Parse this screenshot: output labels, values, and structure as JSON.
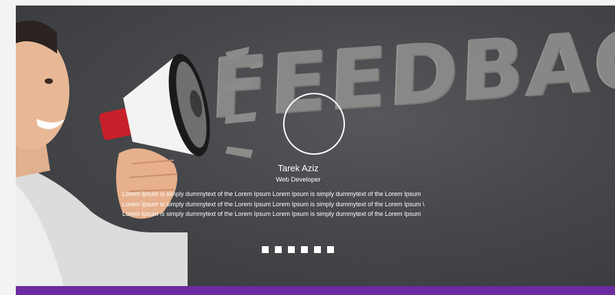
{
  "hero": {
    "background_word": "FEEDBAC",
    "testimonial": {
      "name": "Tarek Aziz",
      "role": "Web Developer",
      "lines": [
        "Lorem Ipsum is simply dummytext of the Lorem Ipsum Lorem Ipsum is simply dummytext of the Lorem Ipsum",
        "Lorem Ipsum is simply dummytext of the Lorem Ipsum Lorem Ipsum is simply dummytext of the Lorem Ipsum \\",
        "Lorem Ipsum is simply dummytext of the Lorem Ipsum Lorem Ipsum is simply dummytext of the Lorem Ipsum"
      ]
    },
    "slider": {
      "total_slides": 6
    }
  },
  "colors": {
    "accent": "#6a2ca0",
    "banner_bg": "#45474a",
    "text": "#ffffff"
  },
  "icons": {
    "avatar": "avatar-circle-outline",
    "megaphone": "megaphone-illustration"
  }
}
